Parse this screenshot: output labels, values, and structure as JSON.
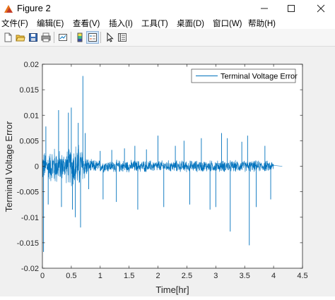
{
  "window": {
    "title": "Figure 2",
    "icons": [
      "matlab-figure-icon",
      "minimize-icon",
      "maximize-icon",
      "close-icon"
    ]
  },
  "menu": {
    "items": [
      "文件(F)",
      "编辑(E)",
      "查看(V)",
      "插入(I)",
      "工具(T)",
      "桌面(D)",
      "窗口(W)",
      "帮助(H)"
    ]
  },
  "toolbar": {
    "icons": [
      "new-figure-icon",
      "open-file-icon",
      "save-icon",
      "print-icon",
      "link-plot-icon",
      "insert-colorbar-icon",
      "insert-legend-icon",
      "pointer-icon",
      "property-inspector-icon"
    ]
  },
  "chart_data": {
    "type": "line",
    "xlabel": "Time[hr]",
    "ylabel": "Terminal Voltage Error",
    "xlim": [
      0,
      4.5
    ],
    "ylim": [
      -0.02,
      0.02
    ],
    "x_ticks": [
      "0",
      "0.5",
      "1",
      "1.5",
      "2",
      "2.5",
      "3",
      "3.5",
      "4",
      "4.5"
    ],
    "y_ticks": [
      "-0.02",
      "-0.015",
      "-0.01",
      "-0.005",
      "0",
      "0.005",
      "0.01",
      "0.015",
      "0.02"
    ],
    "legend": "top-right",
    "grid": false,
    "series": [
      {
        "name": "Terminal Voltage Error",
        "color": "#0072bd",
        "noise_envelope": [
          [
            0.0,
            0.0035
          ],
          [
            0.1,
            0.003
          ],
          [
            0.2,
            0.0045
          ],
          [
            0.35,
            0.003
          ],
          [
            0.5,
            0.0045
          ],
          [
            0.6,
            0.0055
          ],
          [
            0.7,
            0.004
          ],
          [
            0.8,
            0.0015
          ],
          [
            1.0,
            0.0014
          ],
          [
            2.0,
            0.0013
          ],
          [
            3.0,
            0.0013
          ],
          [
            3.5,
            0.0013
          ],
          [
            4.0,
            0.0012
          ],
          [
            4.01,
            0.0
          ]
        ],
        "spikes": [
          {
            "x": 0.02,
            "y": -0.0168
          },
          {
            "x": 0.06,
            "y": 0.0078
          },
          {
            "x": 0.1,
            "y": -0.0075
          },
          {
            "x": 0.28,
            "y": 0.011
          },
          {
            "x": 0.33,
            "y": -0.008
          },
          {
            "x": 0.45,
            "y": 0.0105
          },
          {
            "x": 0.5,
            "y": 0.0115
          },
          {
            "x": 0.52,
            "y": -0.0085
          },
          {
            "x": 0.57,
            "y": -0.01
          },
          {
            "x": 0.62,
            "y": 0.0085
          },
          {
            "x": 0.66,
            "y": -0.012
          },
          {
            "x": 0.7,
            "y": 0.0177
          },
          {
            "x": 0.74,
            "y": 0.0065
          },
          {
            "x": 0.8,
            "y": -0.0045
          },
          {
            "x": 1.0,
            "y": 0.003
          },
          {
            "x": 1.05,
            "y": -0.0065
          },
          {
            "x": 1.2,
            "y": 0.0032
          },
          {
            "x": 1.28,
            "y": -0.007
          },
          {
            "x": 1.42,
            "y": 0.0035
          },
          {
            "x": 1.6,
            "y": 0.004
          },
          {
            "x": 1.65,
            "y": -0.0085
          },
          {
            "x": 1.8,
            "y": 0.0033
          },
          {
            "x": 2.0,
            "y": 0.006
          },
          {
            "x": 2.1,
            "y": -0.008
          },
          {
            "x": 2.3,
            "y": 0.004
          },
          {
            "x": 2.45,
            "y": 0.005
          },
          {
            "x": 2.55,
            "y": -0.0075
          },
          {
            "x": 2.75,
            "y": 0.0055
          },
          {
            "x": 2.9,
            "y": -0.0085
          },
          {
            "x": 3.0,
            "y": -0.008
          },
          {
            "x": 3.1,
            "y": 0.0065
          },
          {
            "x": 3.2,
            "y": 0.0055
          },
          {
            "x": 3.25,
            "y": -0.0128
          },
          {
            "x": 3.45,
            "y": 0.0048
          },
          {
            "x": 3.55,
            "y": 0.006
          },
          {
            "x": 3.58,
            "y": -0.0155
          },
          {
            "x": 3.7,
            "y": -0.008
          },
          {
            "x": 3.85,
            "y": 0.004
          },
          {
            "x": 3.95,
            "y": -0.0065
          }
        ],
        "tail": [
          4.0,
          4.15
        ]
      }
    ]
  }
}
